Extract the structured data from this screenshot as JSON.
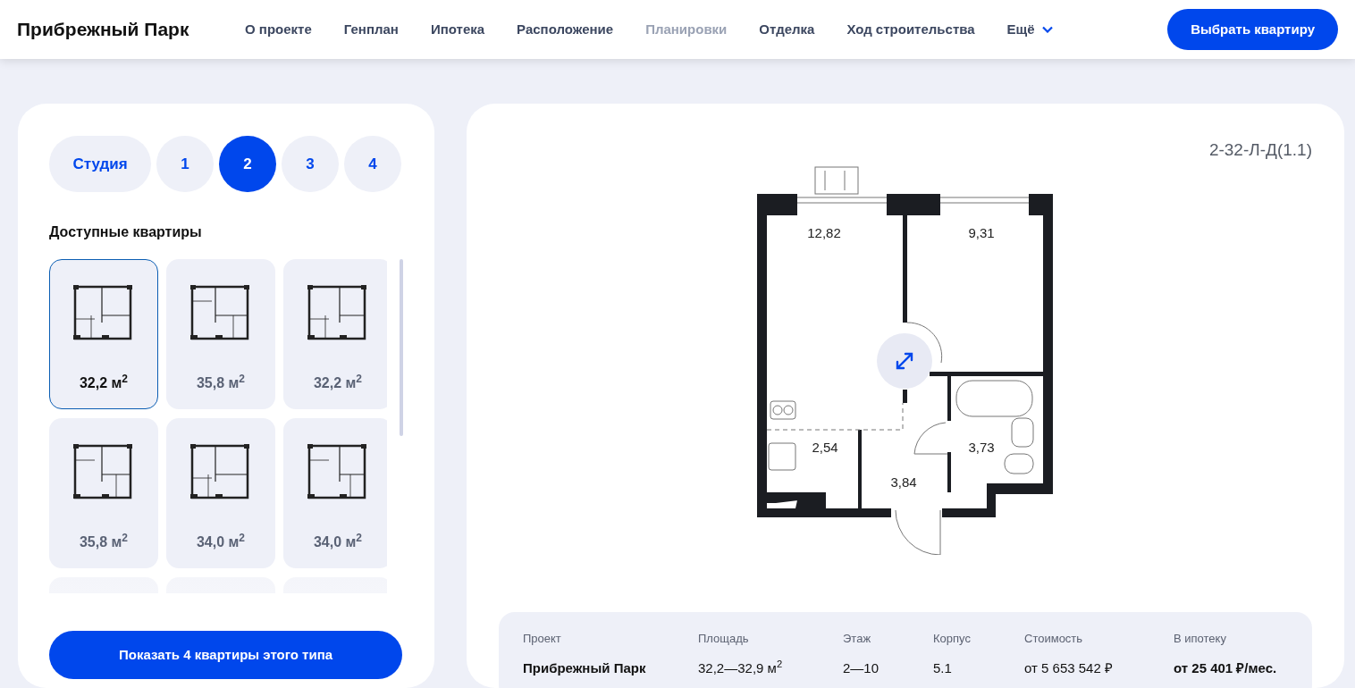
{
  "header": {
    "logo": "Прибрежный Парк",
    "nav": [
      {
        "label": "О проекте",
        "selected": false
      },
      {
        "label": "Генплан",
        "selected": false
      },
      {
        "label": "Ипотека",
        "selected": false
      },
      {
        "label": "Расположение",
        "selected": false
      },
      {
        "label": "Планировки",
        "selected": true
      },
      {
        "label": "Отделка",
        "selected": false
      },
      {
        "label": "Ход строительства",
        "selected": false
      },
      {
        "label": "Ещё",
        "selected": false,
        "kind": "dropdown"
      }
    ],
    "cta": "Выбрать квартиру"
  },
  "room_types": [
    {
      "label": "Студия",
      "selected": false
    },
    {
      "label": "1",
      "selected": false
    },
    {
      "label": "2",
      "selected": true
    },
    {
      "label": "3",
      "selected": false
    },
    {
      "label": "4",
      "selected": false
    }
  ],
  "list_title": "Доступные квартиры",
  "apartments": [
    {
      "kind": "full",
      "area": "32,2 м$^{2}$",
      "selected": true
    },
    {
      "kind": "full",
      "area": "35,8 м$^{2}$",
      "selected": false
    },
    {
      "kind": "full",
      "area": "32,2 м$^{2}$",
      "selected": false
    },
    {
      "kind": "full",
      "area": "35,8 м$^{2}$",
      "selected": false
    },
    {
      "kind": "full",
      "area": "34,0 м$^{2}$",
      "selected": false
    },
    {
      "kind": "full",
      "area": "34,0 м$^{2}$",
      "selected": false
    },
    {
      "kind": "partial"
    },
    {
      "kind": "partial"
    },
    {
      "kind": "partial"
    }
  ],
  "show_button": "Показать 4 квартиры этого типа",
  "plan": {
    "code": "2-32-Л-Д(1.1)",
    "rooms": [
      "12,82",
      "9,31",
      "2,54",
      "3,73",
      "3,84"
    ]
  },
  "info": [
    {
      "label": "Проект",
      "value": "Прибрежный Парк",
      "bold": true
    },
    {
      "label": "Площадь",
      "value": "32,2—32,9 м$^{2}$",
      "bold": false
    },
    {
      "label": "Этаж",
      "value": "2—10",
      "bold": false
    },
    {
      "label": "Корпус",
      "value": "5.1",
      "bold": false
    },
    {
      "label": "Стоимость",
      "value": "от 5 653 542 ₽",
      "bold": false
    },
    {
      "label": "В ипотеку",
      "value": "от 25 401 ₽/мес.",
      "bold": true
    }
  ]
}
